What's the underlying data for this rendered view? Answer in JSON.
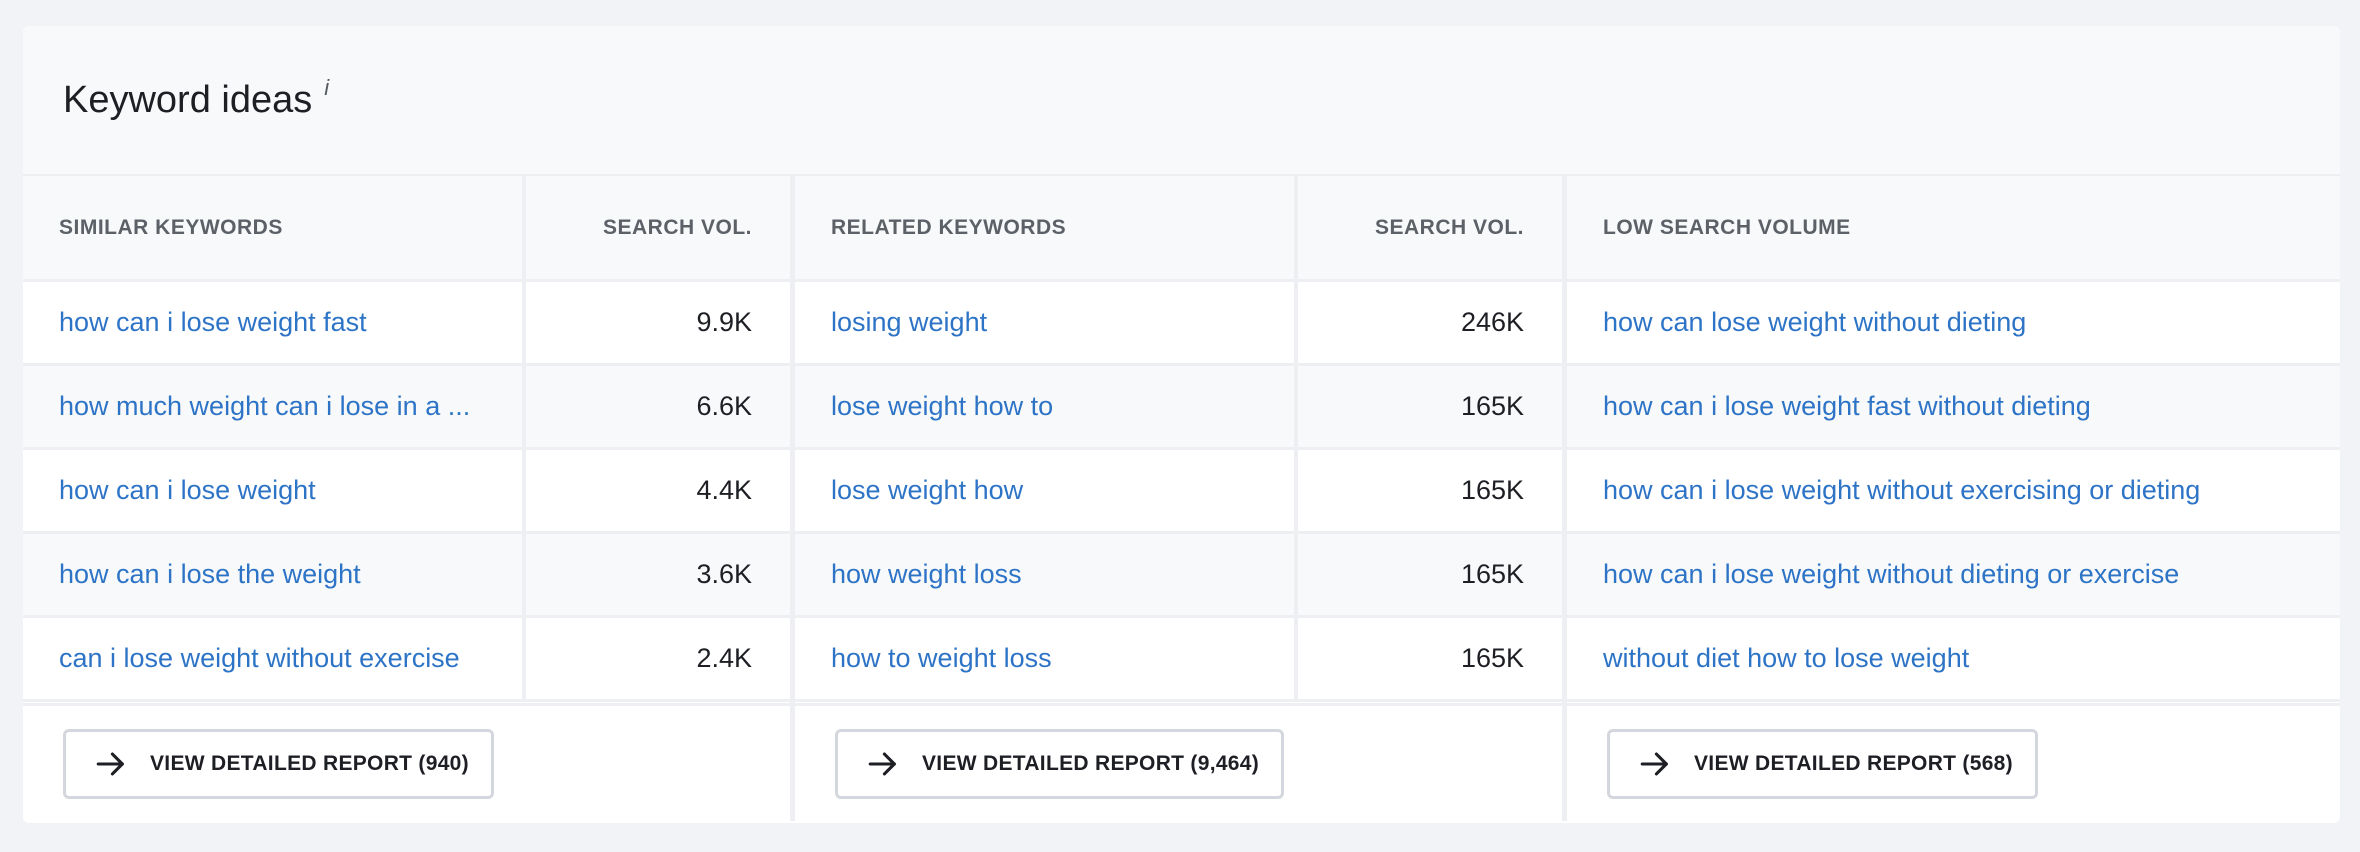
{
  "title": "Keyword ideas",
  "info_mark": "i",
  "columns": [
    {
      "header_kw": "SIMILAR KEYWORDS",
      "header_vol": "SEARCH VOL.",
      "rows": [
        {
          "keyword": "how can i lose weight fast",
          "volume": "9.9K"
        },
        {
          "keyword": "how much weight can i lose in a ...",
          "volume": "6.6K"
        },
        {
          "keyword": "how can i lose weight",
          "volume": "4.4K"
        },
        {
          "keyword": "how can i lose the weight",
          "volume": "3.6K"
        },
        {
          "keyword": "can i lose weight without exercise",
          "volume": "2.4K"
        }
      ],
      "button_label": "VIEW DETAILED REPORT (940)"
    },
    {
      "header_kw": "RELATED KEYWORDS",
      "header_vol": "SEARCH VOL.",
      "rows": [
        {
          "keyword": "losing weight",
          "volume": "246K"
        },
        {
          "keyword": "lose weight how to",
          "volume": "165K"
        },
        {
          "keyword": "lose weight how",
          "volume": "165K"
        },
        {
          "keyword": "how weight loss",
          "volume": "165K"
        },
        {
          "keyword": "how to weight loss",
          "volume": "165K"
        }
      ],
      "button_label": "VIEW DETAILED REPORT (9,464)"
    },
    {
      "header_kw": "LOW SEARCH VOLUME",
      "rows": [
        {
          "keyword": "how can lose weight without dieting"
        },
        {
          "keyword": "how can i lose weight fast without dieting"
        },
        {
          "keyword": "how can i lose weight without exercising or dieting"
        },
        {
          "keyword": "how can i lose weight without dieting or exercise"
        },
        {
          "keyword": "without diet how to lose weight"
        }
      ],
      "button_label": "VIEW DETAILED REPORT (568)"
    }
  ],
  "colors": {
    "link": "#2e74c6",
    "header_bg": "#f8f9fb",
    "divider": "#eeeff2"
  },
  "icons": {
    "button_icon": "arrow-right-icon"
  }
}
